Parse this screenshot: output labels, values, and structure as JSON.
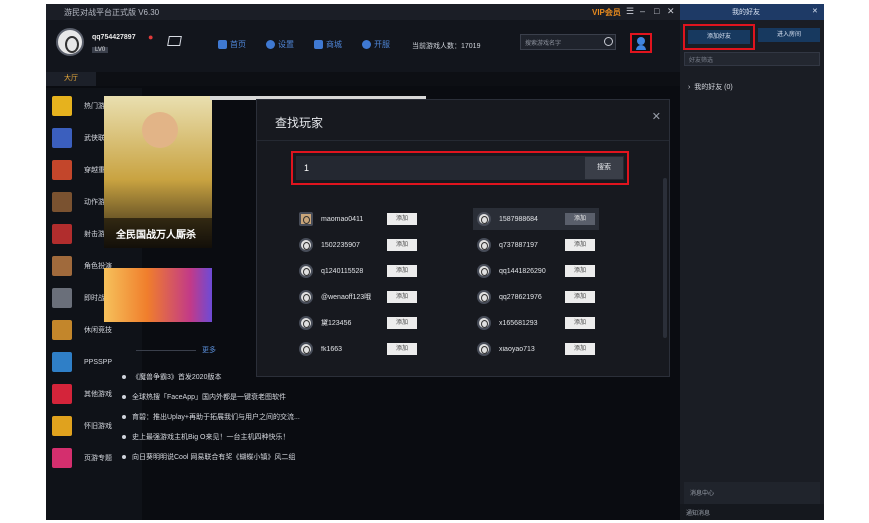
{
  "titlebar": {
    "title": "游民对战平台正式版 V6.30",
    "vip": "VIP会员",
    "controls": [
      "☰",
      "–",
      "□",
      "✕"
    ]
  },
  "user": {
    "name": "qq754427897",
    "level": "LV0"
  },
  "nav": [
    {
      "label": "首页",
      "icon": "home-icon"
    },
    {
      "label": "设置",
      "icon": "gear-icon"
    },
    {
      "label": "商城",
      "icon": "shop-icon"
    },
    {
      "label": "开服",
      "icon": "server-icon"
    }
  ],
  "online": "当前游戏人数：17019",
  "search": {
    "placeholder": "搜索游戏名字"
  },
  "tab": "大厅",
  "sidebar": [
    {
      "label": "热门游戏",
      "color": "#e6b21e"
    },
    {
      "label": "武侠联网",
      "color": "#3b5fbe"
    },
    {
      "label": "穿越重生",
      "color": "#c3462b"
    },
    {
      "label": "动作游戏",
      "color": "#7a5230"
    },
    {
      "label": "射击游戏",
      "color": "#b12d2d"
    },
    {
      "label": "角色扮演",
      "color": "#a06a3c"
    },
    {
      "label": "即时战略",
      "color": "#6a6f7a"
    },
    {
      "label": "休闲竞技",
      "color": "#c3862b"
    },
    {
      "label": "PPSSPP",
      "color": "#2f7fc7"
    },
    {
      "label": "其他游戏",
      "color": "#d4243a"
    },
    {
      "label": "怀旧游戏",
      "color": "#e0a21e"
    },
    {
      "label": "页游专题",
      "color": "#d42f6e"
    }
  ],
  "banner": {
    "caption": "全民国战万人厮杀"
  },
  "more": "更多",
  "news": [
    "《魔兽争霸3》首发2020版本",
    "全球热搜「FaceApp」国内外都是一键衰老图软件",
    "育碧：推出Uplay+再助于拓展我们与用户之间的交流...",
    "史上最强游戏主机Big O来见！一台主机四种快乐！",
    "向日葵明明说Cool 网易联合有奖《蝴蝶小镇》风二组"
  ],
  "dialog": {
    "title": "查找玩家",
    "input_value": "1",
    "search_btn": "搜索",
    "add_label": "添加",
    "players_left": [
      "maomao0411",
      "1502235907",
      "q1240115528",
      "@wenaoff123哦",
      "黛123456",
      "fk1663"
    ],
    "players_right": [
      "1587988684",
      "q737887197",
      "qq1441826290",
      "qq278621976",
      "x165681293",
      "xiaoyao713"
    ]
  },
  "right_panel": {
    "title": "我的好友",
    "add_friend": "添加好友",
    "room": "进入房间",
    "search_placeholder": "好友筛选",
    "group": "我的好友 (0)",
    "msg_center": "消息中心",
    "notice": "通知消息"
  }
}
